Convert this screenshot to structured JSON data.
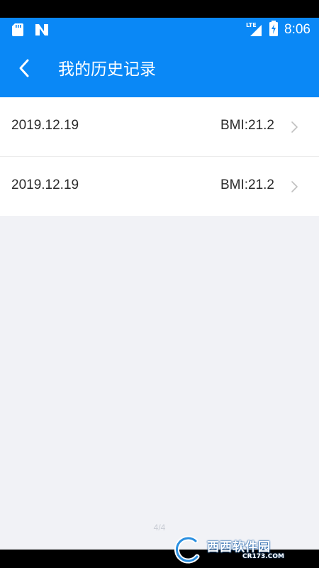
{
  "status_bar": {
    "time": "8:06",
    "network": "LTE",
    "icons": [
      "sd-card-icon",
      "n-notification-icon",
      "signal-icon",
      "battery-charging-icon"
    ]
  },
  "app_bar": {
    "title": "我的历史记录",
    "back_icon": "chevron-left-icon"
  },
  "records": [
    {
      "date": "2019.12.19",
      "bmi": "BMI:21.2"
    },
    {
      "date": "2019.12.19",
      "bmi": "BMI:21.2"
    }
  ],
  "page_indicator": "4/4",
  "watermark": {
    "brand": "西西软件园",
    "url": "CR173.COM"
  },
  "colors": {
    "primary": "#0a88f6",
    "background": "#f1f2f6",
    "text": "#2b2b2b",
    "chevron": "#c0c0c0"
  }
}
